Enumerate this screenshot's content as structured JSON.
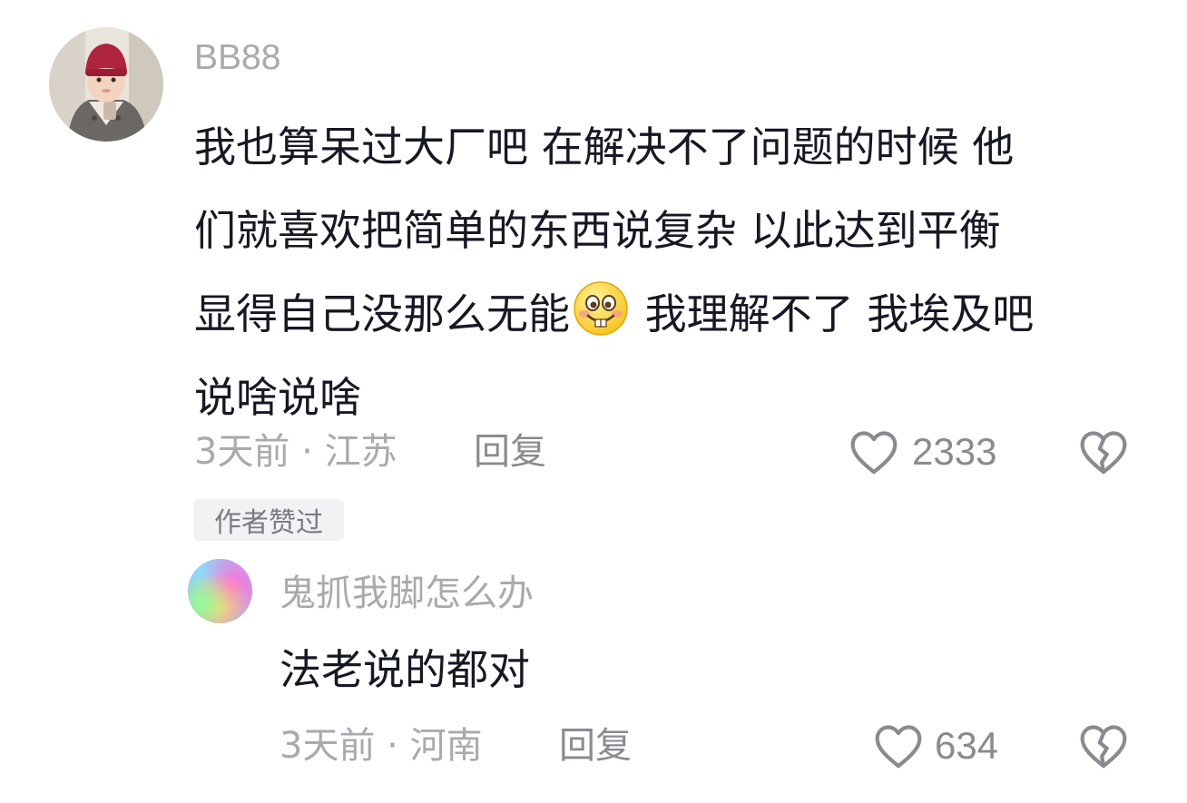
{
  "comments": {
    "main": {
      "username": "BB88",
      "lines": [
        "我也算呆过大厂吧 在解决不了问题的时候 他",
        "们就喜欢把简单的东西说复杂 以此达到平衡",
        "显得自己没那么无能",
        " 我理解不了 我埃及吧",
        "说啥说啥"
      ],
      "emoji_icon": "grinning-buck-tooth-emoji",
      "time_location": "3天前 · 江苏",
      "reply_label": "回复",
      "like_count": "2333",
      "badge": "作者赞过"
    },
    "reply": {
      "username": "鬼抓我脚怎么办",
      "text": "法老说的都对",
      "time_location": "3天前 · 河南",
      "reply_label": "回复",
      "like_count": "634"
    }
  },
  "icons": {
    "like": "heart-outline-icon",
    "dislike": "broken-heart-icon"
  },
  "colors": {
    "text": "#161823",
    "secondary": "#a9a9ae",
    "icon": "#8a8b91",
    "badge_bg": "#f2f2f4"
  }
}
